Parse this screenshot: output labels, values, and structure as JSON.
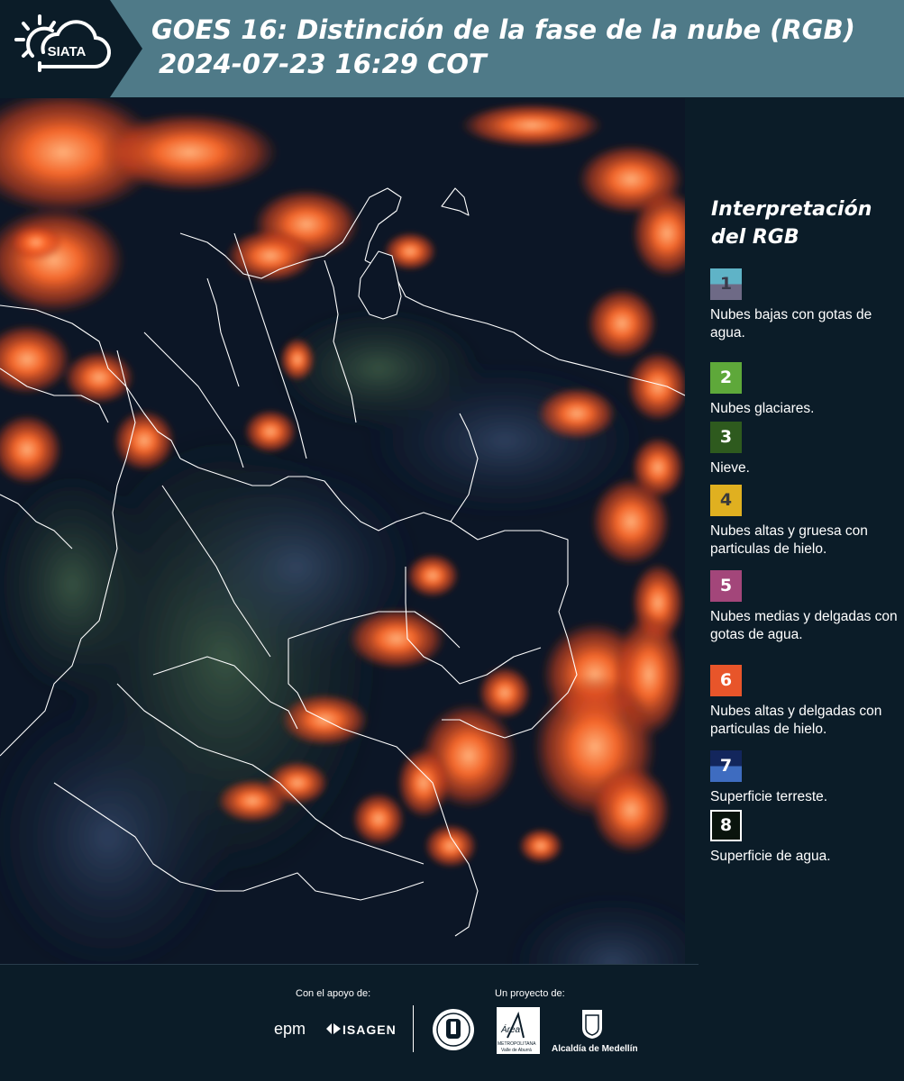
{
  "header": {
    "logo_text": "SIATA",
    "title_line1": "GOES 16: Distinción de la fase de la nube (RGB)",
    "title_line2": "2024-07-23 16:29 COT"
  },
  "legend": {
    "title_line1": "Interpretación",
    "title_line2": "del RGB",
    "items": [
      {
        "num": "1",
        "label": "Nubes bajas con gotas de agua.",
        "color_top": "#5fb3c7",
        "color_bottom": "#6e6a86",
        "num_color": "#3a3a4a"
      },
      {
        "num": "2",
        "label": "Nubes glaciares.",
        "color_top": "#5ea83a",
        "color_bottom": "#5ea83a",
        "num_color": "#ffffff"
      },
      {
        "num": "3",
        "label": "Nieve.",
        "color_top": "#2e5a1e",
        "color_bottom": "#2e5a1e",
        "num_color": "#ffffff"
      },
      {
        "num": "4",
        "label": "Nubes altas y gruesa con particulas de hielo.",
        "color_top": "#e0b020",
        "color_bottom": "#e0b020",
        "num_color": "#3a3a3a"
      },
      {
        "num": "5",
        "label": "Nubes medias y delgadas con gotas de agua.",
        "color_top": "#a3467a",
        "color_bottom": "#a3467a",
        "num_color": "#ffffff"
      },
      {
        "num": "6",
        "label": "Nubes altas y delgadas con particulas de hielo.",
        "color_top": "#e8552a",
        "color_bottom": "#e8552a",
        "num_color": "#ffffff"
      },
      {
        "num": "7",
        "label": "Superficie terreste.",
        "color_top": "#13265c",
        "color_bottom": "#3e6cc0",
        "num_color": "#ffffff"
      },
      {
        "num": "8",
        "label": "Superficie de agua.",
        "color_top": "#0a140d",
        "color_bottom": "#0a140d",
        "num_color": "#ffffff"
      }
    ]
  },
  "footer": {
    "support_label": "Con el apoyo de:",
    "project_label": "Un proyecto de:",
    "epm_logo": "epm",
    "isagen_logo": "ISAGEN",
    "area_logo_script": "Área",
    "area_logo_line1": "METROPOLITANA",
    "area_logo_line2": "Valle de Aburrá",
    "alcaldia_logo": "Alcaldía de Medellín"
  },
  "colors": {
    "header_band": "#4f7a88",
    "background": "#0b1c28",
    "cloud_orange": "#ff6a2a"
  }
}
